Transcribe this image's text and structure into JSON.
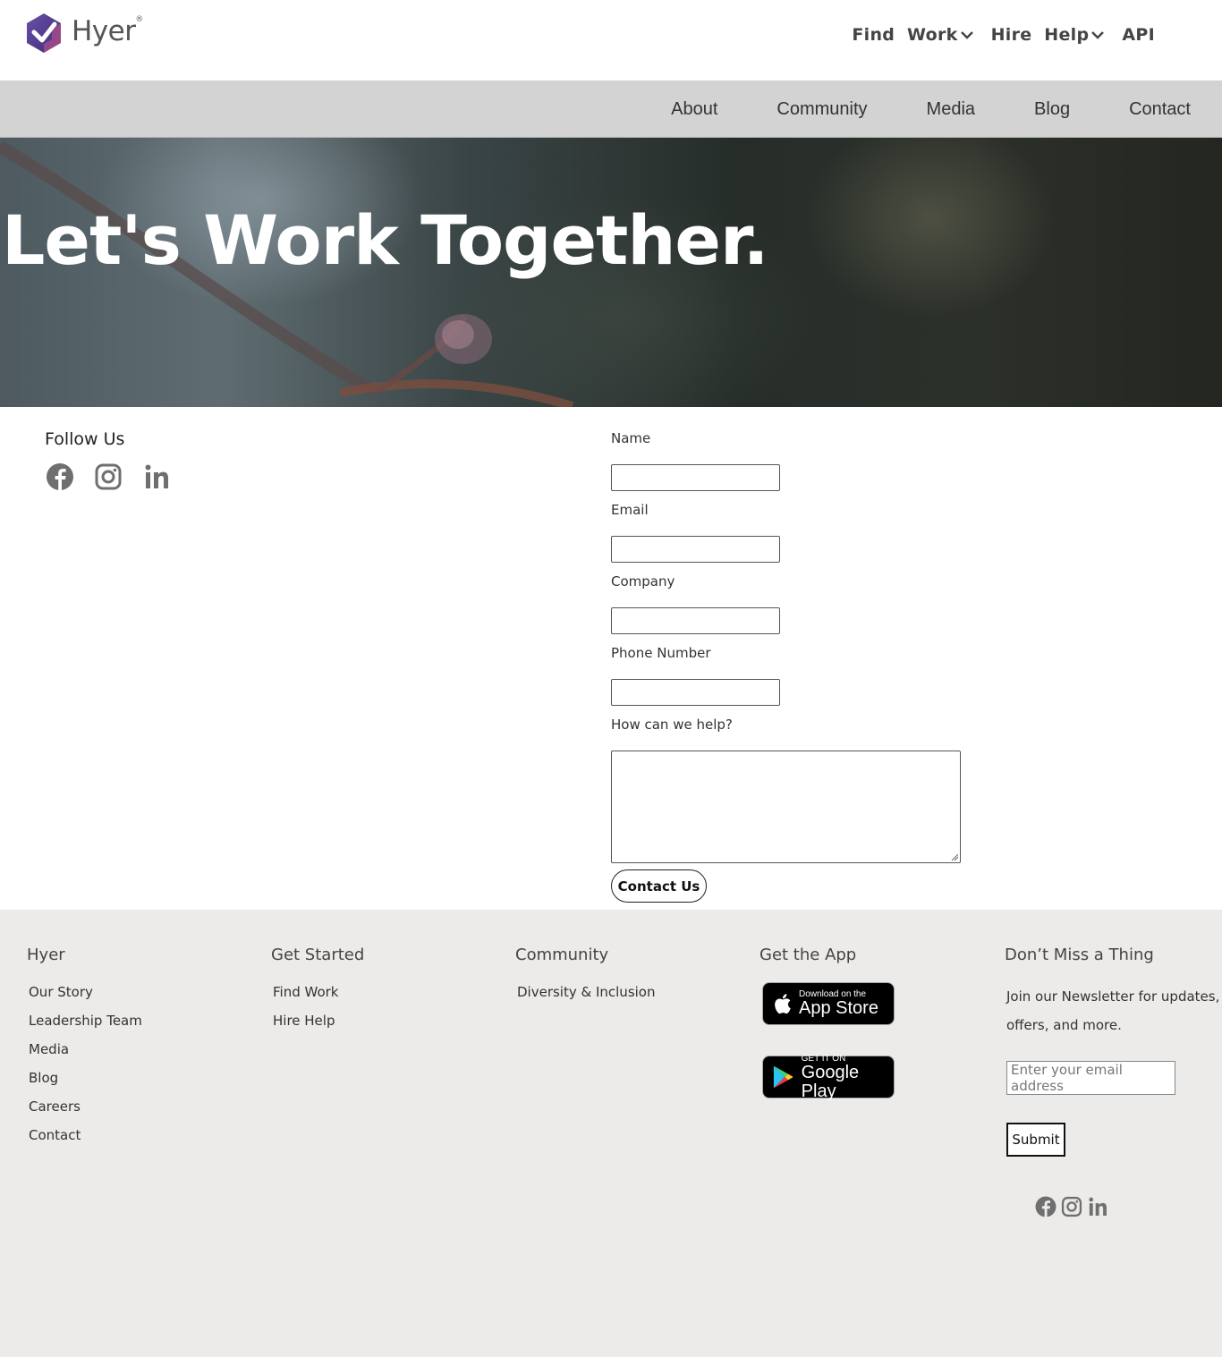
{
  "header": {
    "brand": "Hyer",
    "brand_mark": "®",
    "nav": [
      {
        "label": "Find  Work",
        "icon": "chevron-down-icon"
      },
      {
        "label": "Hire  Help",
        "icon": "chevron-down-icon"
      },
      {
        "label": "API"
      }
    ]
  },
  "subnav": {
    "items": [
      "About",
      "Community",
      "Media",
      "Blog",
      "Contact"
    ]
  },
  "hero": {
    "title": "Let's Work Together."
  },
  "follow": {
    "title": "Follow Us",
    "icons": [
      "facebook-icon",
      "instagram-icon",
      "linkedin-icon"
    ]
  },
  "form": {
    "name_label": "Name",
    "email_label": "Email",
    "company_label": "Company",
    "phone_label": "Phone Number",
    "help_label": "How can we help?",
    "submit_label": "Contact Us"
  },
  "footer": {
    "hyer": {
      "title": "Hyer",
      "links": [
        "Our Story",
        "Leadership Team",
        "Media",
        "Blog",
        "Careers",
        "Contact"
      ]
    },
    "get_started": {
      "title": "Get Started",
      "links": [
        "Find Work",
        "Hire Help"
      ]
    },
    "community": {
      "title": "Community",
      "links": [
        "Diversity & Inclusion"
      ]
    },
    "app": {
      "title": "Get the App",
      "app_store_small": "Download on the",
      "app_store_big": "App Store",
      "google_small": "GET IT ON",
      "google_big": "Google Play"
    },
    "newsletter": {
      "title": "Don’t Miss a Thing",
      "text": "Join our Newsletter for updates, offers, and more.",
      "email_placeholder": "Enter your email address",
      "submit_label": "Submit"
    }
  },
  "colors": {
    "subnav_bg": "#d3d3d3",
    "footer_bg": "#ecebe9",
    "icon_gray": "#6f6f6f",
    "logo_purple": "#5b3f8f"
  }
}
